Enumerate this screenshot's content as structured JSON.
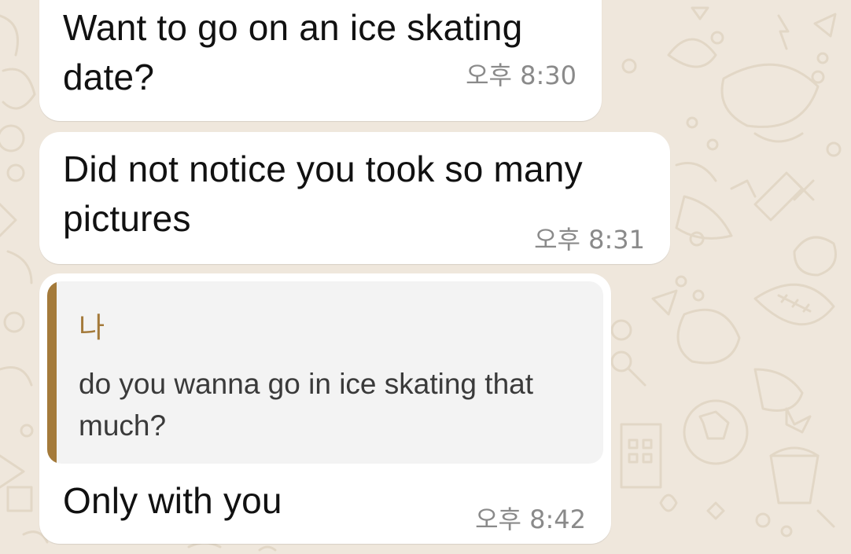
{
  "messages": [
    {
      "text": "Want to go on an ice skating date?",
      "time": "오후 8:30"
    },
    {
      "text": "Did not notice you took so many pictures",
      "time": "오후 8:31"
    },
    {
      "quote": {
        "author": "나",
        "text": "do you wanna go in ice skating that much?"
      },
      "text": "Only with you",
      "time": "오후 8:42"
    }
  ],
  "colors": {
    "wallpaper": "#efe7dc",
    "bubble": "#ffffff",
    "quote_accent": "#a47a3a",
    "timestamp": "#8a8a8a"
  }
}
